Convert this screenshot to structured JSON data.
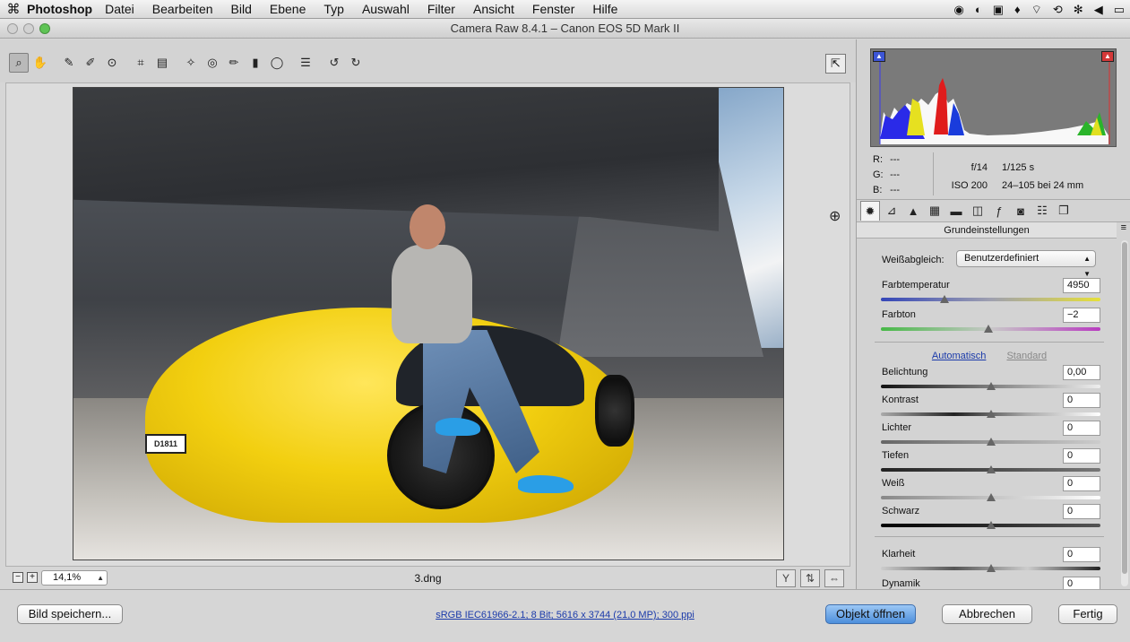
{
  "menubar": {
    "apple_icon": "apple-logo-icon",
    "app_name": "Photoshop",
    "menus": [
      "Datei",
      "Bearbeiten",
      "Bild",
      "Ebene",
      "Typ",
      "Auswahl",
      "Filter",
      "Ansicht",
      "Fenster",
      "Hilfe"
    ]
  },
  "window": {
    "title": "Camera Raw 8.4.1 – Canon EOS 5D Mark II"
  },
  "preview": {
    "zoom": "14,1%",
    "filename": "3.dng",
    "plate_text": "D1811"
  },
  "histogram": {
    "r_label": "R:",
    "r_value": "---",
    "g_label": "G:",
    "g_value": "---",
    "b_label": "B:",
    "b_value": "---",
    "aperture": "f/14",
    "shutter": "1/125 s",
    "iso": "ISO 200",
    "lens": "24–105 bei 24 mm"
  },
  "panel": {
    "section_title": "Grundeinstellungen",
    "white_balance_label": "Weißabgleich:",
    "white_balance_value": "Benutzerdefiniert",
    "auto_link": "Automatisch",
    "standard_link": "Standard",
    "sliders": [
      {
        "label": "Farbtemperatur",
        "value": "4950",
        "position": 0.29
      },
      {
        "label": "Farbton",
        "value": "−2",
        "position": 0.49
      },
      {
        "label": "Belichtung",
        "value": "0,00",
        "position": 0.5
      },
      {
        "label": "Kontrast",
        "value": "0",
        "position": 0.5
      },
      {
        "label": "Lichter",
        "value": "0",
        "position": 0.5
      },
      {
        "label": "Tiefen",
        "value": "0",
        "position": 0.5
      },
      {
        "label": "Weiß",
        "value": "0",
        "position": 0.5
      },
      {
        "label": "Schwarz",
        "value": "0",
        "position": 0.5
      },
      {
        "label": "Klarheit",
        "value": "0",
        "position": 0.5
      },
      {
        "label": "Dynamik",
        "value": "0",
        "position": 0.5
      }
    ]
  },
  "bottom": {
    "save_label": "Bild speichern...",
    "workflow_link": "sRGB IEC61966-2.1; 8 Bit; 5616 x 3744 (21,0 MP); 300 ppi",
    "open_object_label": "Objekt öffnen",
    "cancel_label": "Abbrechen",
    "done_label": "Fertig"
  },
  "colors": {
    "accent_blue": "#4d8fdc",
    "link_blue": "#1a3aaa",
    "car_yellow": "#f2cf10"
  }
}
